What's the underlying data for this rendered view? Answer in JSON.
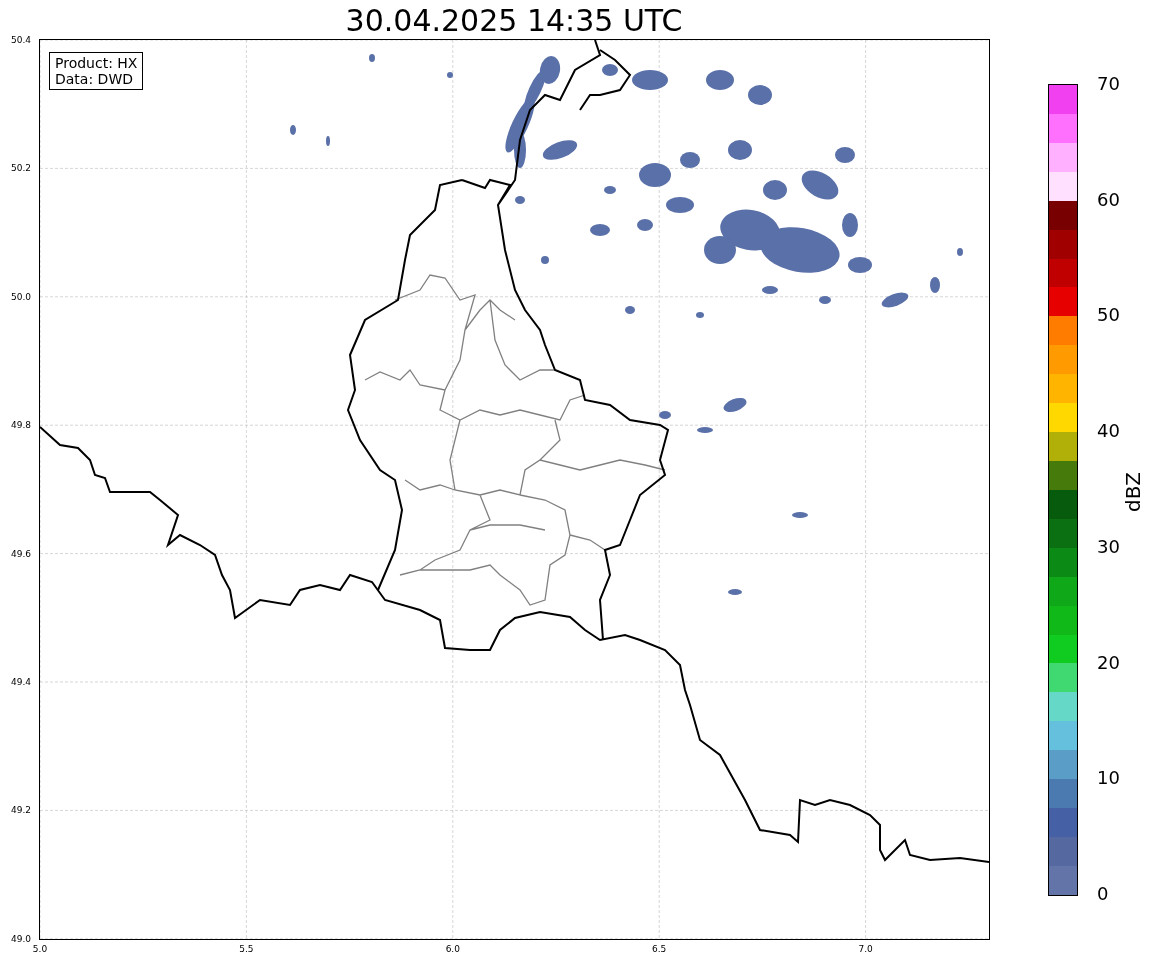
{
  "title": "30.04.2025 14:35 UTC",
  "info_box": [
    "Product: HX",
    "Data: DWD"
  ],
  "map": {
    "x_ticks": [
      "5.0",
      "5.5",
      "6.0",
      "6.5",
      "7.0"
    ],
    "y_ticks": [
      "50.4",
      "50.2",
      "50.0",
      "49.8",
      "49.6",
      "49.4",
      "49.2",
      "49.0"
    ]
  },
  "colorbar": {
    "label": "dBZ",
    "ticks": [
      "70",
      "60",
      "50",
      "40",
      "30",
      "20",
      "10",
      "0"
    ],
    "segments": [
      {
        "color": "#6374a8"
      },
      {
        "color": "#5568a0"
      },
      {
        "color": "#4560a4"
      },
      {
        "color": "#4a7ab0"
      },
      {
        "color": "#5a9ec8"
      },
      {
        "color": "#64c0dc"
      },
      {
        "color": "#66d8c8"
      },
      {
        "color": "#40d870"
      },
      {
        "color": "#10cc20"
      },
      {
        "color": "#10b818"
      },
      {
        "color": "#0ea818"
      },
      {
        "color": "#0c8a16"
      },
      {
        "color": "#0a7012"
      },
      {
        "color": "#065c0c"
      },
      {
        "color": "#467a0a"
      },
      {
        "color": "#b0b008"
      },
      {
        "color": "#ffd800"
      },
      {
        "color": "#ffb400"
      },
      {
        "color": "#ff9a00"
      },
      {
        "color": "#ff7c00"
      },
      {
        "color": "#e60000"
      },
      {
        "color": "#c00000"
      },
      {
        "color": "#a00000"
      },
      {
        "color": "#780000"
      },
      {
        "color": "#ffe0ff"
      },
      {
        "color": "#ffb0ff"
      },
      {
        "color": "#ff70ff"
      },
      {
        "color": "#f040f0"
      }
    ]
  }
}
